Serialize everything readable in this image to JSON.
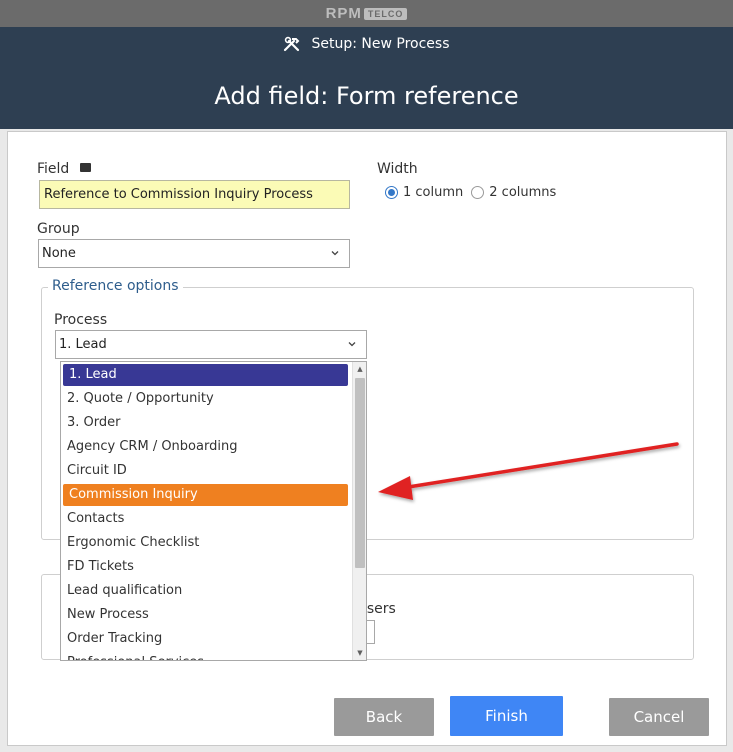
{
  "app": {
    "logo_main": "RPM",
    "logo_sub": "TELCO"
  },
  "header": {
    "breadcrumb": "Setup: New Process",
    "title": "Add field: Form reference"
  },
  "form": {
    "field_label": "Field",
    "field_value": "Reference to Commission Inquiry Process",
    "width_label": "Width",
    "width_options": [
      "1 column",
      "2 columns"
    ],
    "width_selected": "1 column",
    "group_label": "Group",
    "group_value": "None",
    "reference_options_legend": "Reference options",
    "process_label": "Process",
    "process_value": "1. Lead",
    "users_label": "users"
  },
  "dropdown": {
    "items": [
      "1. Lead",
      "2. Quote / Opportunity",
      "3. Order",
      "Agency CRM / Onboarding",
      "Circuit ID",
      "Commission Inquiry",
      "Contacts",
      "Ergonomic Checklist",
      "FD Tickets",
      "Lead qualification",
      "New Process",
      "Order Tracking",
      "Professional Services"
    ],
    "selected": "1. Lead",
    "highlighted": "Commission Inquiry"
  },
  "buttons": {
    "back": "Back",
    "finish": "Finish",
    "cancel": "Cancel"
  },
  "colors": {
    "header_bg": "#2e3f52",
    "selected_item": "#383895",
    "highlight_item": "#ef8020",
    "finish_button": "#3f86f5",
    "arrow": "#e02020"
  }
}
